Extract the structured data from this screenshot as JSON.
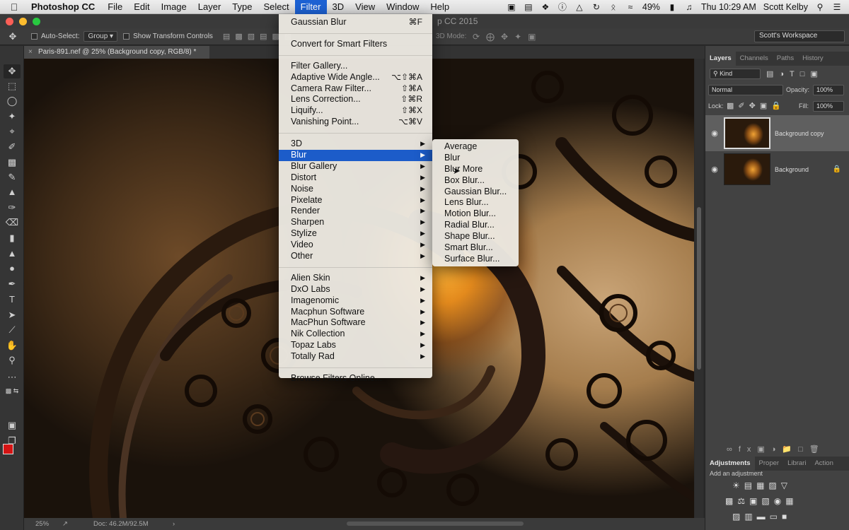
{
  "menubar": {
    "app_name": "Photoshop CC",
    "items": [
      "File",
      "Edit",
      "Image",
      "Layer",
      "Type",
      "Select",
      "Filter",
      "3D",
      "View",
      "Window",
      "Help"
    ],
    "active": "Filter",
    "battery": "49%",
    "clock": "Thu 10:29 AM",
    "user": "Scott Kelby"
  },
  "window": {
    "title_fragment": "p CC 2015"
  },
  "options": {
    "auto_select_label": "Auto-Select:",
    "auto_select_value": "Group",
    "transform_label": "Show Transform Controls",
    "mode_3d_label": "3D Mode:",
    "workspace": "Scott's Workspace"
  },
  "document": {
    "tab_title": "Paris-891.nef @ 25% (Background copy, RGB/8) *",
    "zoom": "25%",
    "doc_size": "Doc: 46.2M/92.5M"
  },
  "filter_menu": {
    "top": [
      {
        "label": "Gaussian Blur",
        "shortcut": "⌘F"
      }
    ],
    "smart": [
      {
        "label": "Convert for Smart Filters"
      }
    ],
    "gallery": [
      {
        "label": "Filter Gallery..."
      },
      {
        "label": "Adaptive Wide Angle...",
        "shortcut": "⌥⇧⌘A"
      },
      {
        "label": "Camera Raw Filter...",
        "shortcut": "⇧⌘A"
      },
      {
        "label": "Lens Correction...",
        "shortcut": "⇧⌘R"
      },
      {
        "label": "Liquify...",
        "shortcut": "⇧⌘X"
      },
      {
        "label": "Vanishing Point...",
        "shortcut": "⌥⌘V"
      }
    ],
    "groups": [
      "3D",
      "Blur",
      "Blur Gallery",
      "Distort",
      "Noise",
      "Pixelate",
      "Render",
      "Sharpen",
      "Stylize",
      "Video",
      "Other"
    ],
    "highlighted": "Blur",
    "plugins": [
      "Alien Skin",
      "DxO Labs",
      "Imagenomic",
      "Macphun Software",
      "MacPhun Software",
      "Nik Collection",
      "Topaz Labs",
      "Totally Rad"
    ],
    "browse": "Browse Filters Online..."
  },
  "blur_submenu": [
    "Average",
    "Blur",
    "Blur More",
    "Box Blur...",
    "Gaussian Blur...",
    "Lens Blur...",
    "Motion Blur...",
    "Radial Blur...",
    "Shape Blur...",
    "Smart Blur...",
    "Surface Blur..."
  ],
  "layers_panel": {
    "tabs": [
      "Layers",
      "Channels",
      "Paths",
      "History"
    ],
    "kind_filter": "Kind",
    "blend_mode": "Normal",
    "opacity_label": "Opacity:",
    "opacity": "100%",
    "lock_label": "Lock:",
    "fill_label": "Fill:",
    "fill": "100%",
    "layers": [
      {
        "name": "Background copy",
        "selected": true
      },
      {
        "name": "Background",
        "locked": true
      }
    ]
  },
  "adjustments_panel": {
    "tabs": [
      "Adjustments",
      "Proper",
      "Librari",
      "Action"
    ],
    "hint": "Add an adjustment"
  },
  "colors": {
    "foreground": "#d51414",
    "background": "#ffffff",
    "menu_highlight": "#1c5cc9"
  }
}
